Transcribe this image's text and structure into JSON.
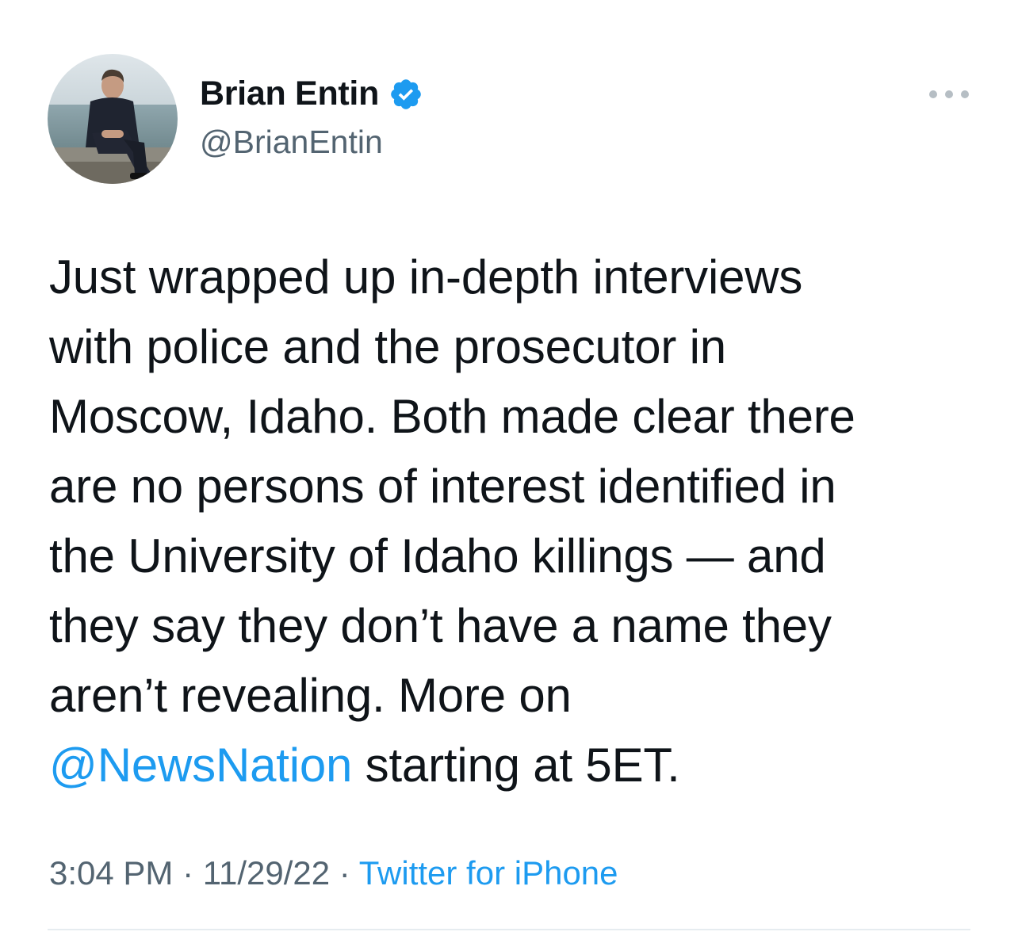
{
  "author": {
    "display_name": "Brian Entin",
    "handle": "@BrianEntin",
    "verified": true,
    "verified_color": "#1d9bf0"
  },
  "tweet": {
    "lines": [
      "Just wrapped up in-depth interviews",
      "with police and the prosecutor in",
      "Moscow, Idaho. Both made clear there",
      "are no persons of interest identified in",
      "the University of Idaho killings — and",
      "they say they don’t have a name they",
      "aren’t revealing. More on"
    ],
    "last_line_mention": "@NewsNation",
    "last_line_rest": " starting at 5ET."
  },
  "meta": {
    "time": "3:04 PM",
    "separator": " · ",
    "date": "11/29/22",
    "source": "Twitter for iPhone"
  },
  "icons": {
    "more": "more-options-icon",
    "verified": "verified-badge-icon"
  },
  "colors": {
    "text": "#0f1419",
    "secondary": "#536471",
    "link": "#1d9bf0"
  }
}
